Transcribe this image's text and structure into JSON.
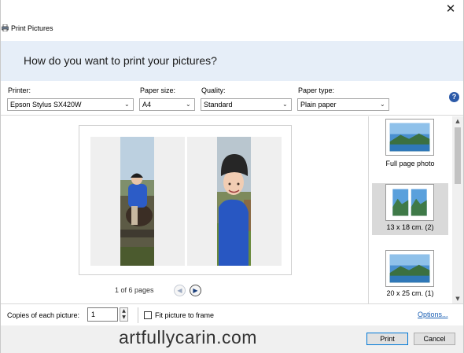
{
  "window": {
    "title": "Print Pictures",
    "close_glyph": "✕"
  },
  "header": {
    "question": "How do you want to print your pictures?"
  },
  "options": {
    "printer": {
      "label": "Printer:",
      "value": "Epson Stylus SX420W"
    },
    "paper_size": {
      "label": "Paper size:",
      "value": "A4"
    },
    "quality": {
      "label": "Quality:",
      "value": "Standard"
    },
    "paper_type": {
      "label": "Paper type:",
      "value": "Plain paper"
    },
    "help_glyph": "?"
  },
  "preview": {
    "pager_text": "1 of 6 pages",
    "prev_glyph": "◀",
    "next_glyph": "▶"
  },
  "layouts": {
    "items": [
      {
        "label": "Full page photo",
        "selected": false
      },
      {
        "label": "13 x 18 cm. (2)",
        "selected": true
      },
      {
        "label": "20 x 25 cm. (1)",
        "selected": false
      }
    ],
    "scroll_up_glyph": "▲",
    "scroll_down_glyph": "▼"
  },
  "bottom": {
    "copies_label": "Copies of each picture:",
    "copies_value": "1",
    "fit_label": "Fit picture to frame",
    "fit_checked": false,
    "options_link": "Options..."
  },
  "footer": {
    "watermark": "artfullycarin.com",
    "print_label": "Print",
    "cancel_label": "Cancel"
  },
  "colors": {
    "header_band": "#e6eef8",
    "link": "#1a5fb4",
    "help_icon": "#2c5aa8",
    "selected_layout": "#d9d9d9"
  }
}
